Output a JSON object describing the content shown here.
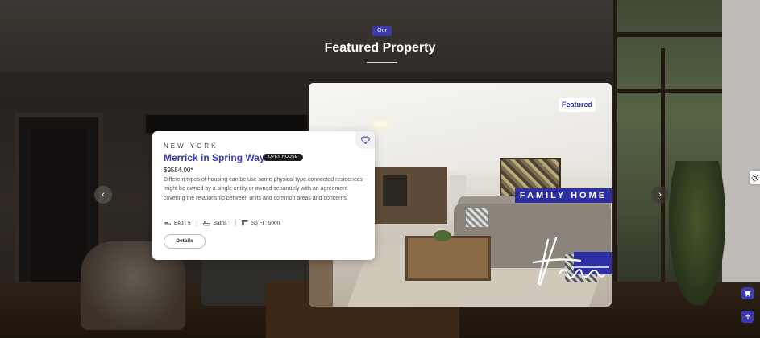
{
  "header": {
    "badge": "Our",
    "title": "Featured Property"
  },
  "property": {
    "city": "NEW YORK",
    "title": "Merrick in Spring Way",
    "status_badge": "OPEN HOUSE",
    "price": "$9554.00*",
    "description": "Different types of housing can be use same physical type.connected residences might be owned by a single entity or owned separately with an agreement covering the relationship between units and common areas and concerns.",
    "features": {
      "bed": "Bed : 5",
      "baths": "Baths :",
      "sqft": "Sq Ft : 5000"
    },
    "details_label": "Details"
  },
  "image": {
    "featured_tag": "Featured",
    "overlay_text": "FAMILY HOME",
    "script_text": "Home"
  },
  "icons": {
    "heart": "heart-icon",
    "bed": "bed-icon",
    "bath": "bath-icon",
    "area": "area-icon",
    "prev": "chevron-left-icon",
    "next": "chevron-right-icon",
    "settings": "gear-icon",
    "cart": "cart-icon",
    "top": "arrow-up-icon"
  },
  "colors": {
    "accent": "#3b3ab2",
    "badge_dark": "#1f1f24",
    "overlay_blue": "#2e2fa3"
  }
}
